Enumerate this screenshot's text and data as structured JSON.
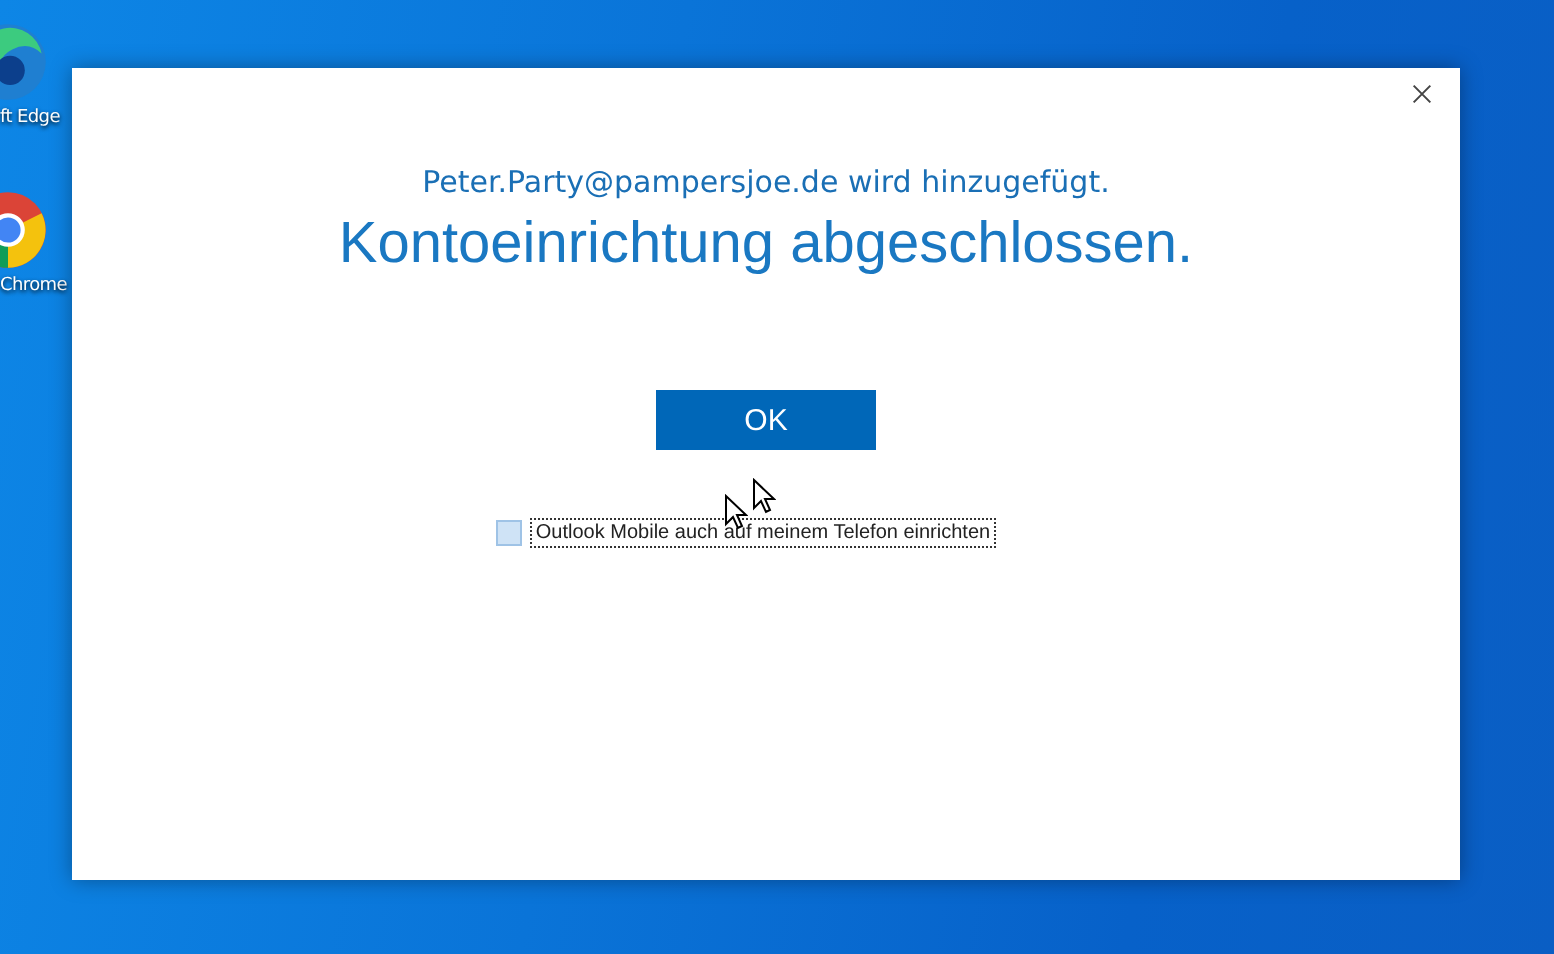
{
  "desktop_icons": [
    {
      "kind": "edge",
      "label": "ft Edge"
    },
    {
      "kind": "chrome",
      "label": "Chrome"
    }
  ],
  "dialog": {
    "subtitle": "Peter.Party@pampersjoe.de wird hinzugefügt.",
    "title": "Kontoeinrichtung abgeschlossen.",
    "ok_button": "OK",
    "checkbox": {
      "label": "Outlook Mobile auch auf meinem Telefon einrichten",
      "checked": false
    }
  }
}
